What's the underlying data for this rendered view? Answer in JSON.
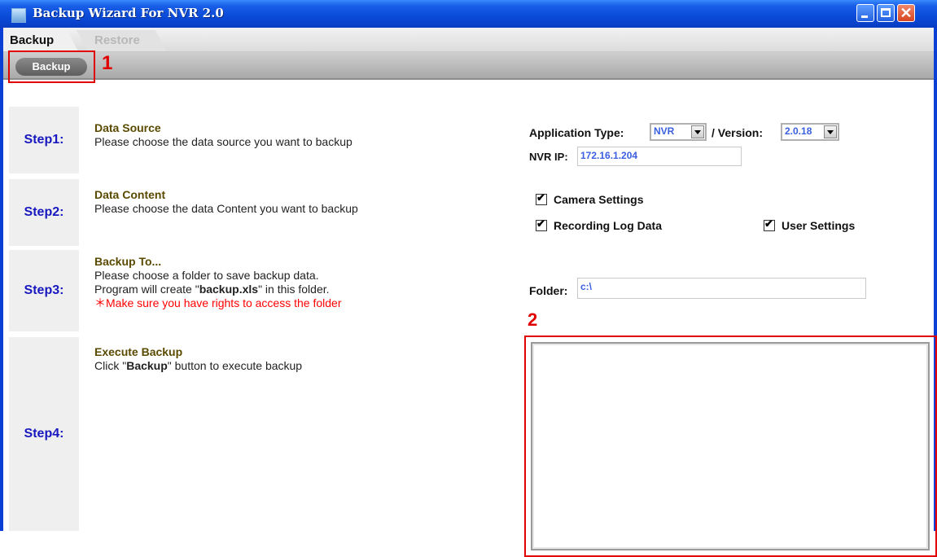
{
  "window": {
    "title": "Backup Wizard For NVR 2.0"
  },
  "tabs": [
    {
      "label": "Backup",
      "active": true
    },
    {
      "label": "Restore",
      "active": false
    }
  ],
  "toolbar": {
    "backup_button": "Backup",
    "annotation_1": "1"
  },
  "steps": [
    {
      "label": "Step1:",
      "heading": "Data Source",
      "lines": [
        "Please choose the data source you want to backup"
      ]
    },
    {
      "label": "Step2:",
      "heading": "Data Content",
      "lines": [
        "Please choose the data Content you want to backup"
      ]
    },
    {
      "label": "Step3:",
      "heading": "Backup To...",
      "lines": [
        "Please choose a folder to save backup data."
      ],
      "line2_prefix": "Program will create \"",
      "line2_bold": "backup.xls",
      "line2_suffix": "\" in this folder.",
      "warning": "＊Make sure you have rights to access the folder"
    },
    {
      "label": "Step4:",
      "heading": "Execute Backup",
      "line_prefix": "Click \"",
      "line_bold": "Backup",
      "line_suffix": "\" button to execute backup"
    }
  ],
  "source": {
    "app_type_label": "Application Type:",
    "app_type_value": "NVR",
    "version_label": "/ Version:",
    "version_value": "2.0.18",
    "ip_label": "NVR IP:",
    "ip_value": "172.16.1.204"
  },
  "content_options": {
    "camera": "Camera Settings",
    "recording": "Recording Log Data",
    "user": "User Settings"
  },
  "destination": {
    "folder_label": "Folder:",
    "folder_value": "c:\\"
  },
  "output": {
    "annotation_2": "2"
  },
  "colors": {
    "title_bar": "#0a4ad8",
    "annotation_red": "#e00000",
    "step_label": "#1818c0",
    "field_text": "#3a5fe0"
  }
}
